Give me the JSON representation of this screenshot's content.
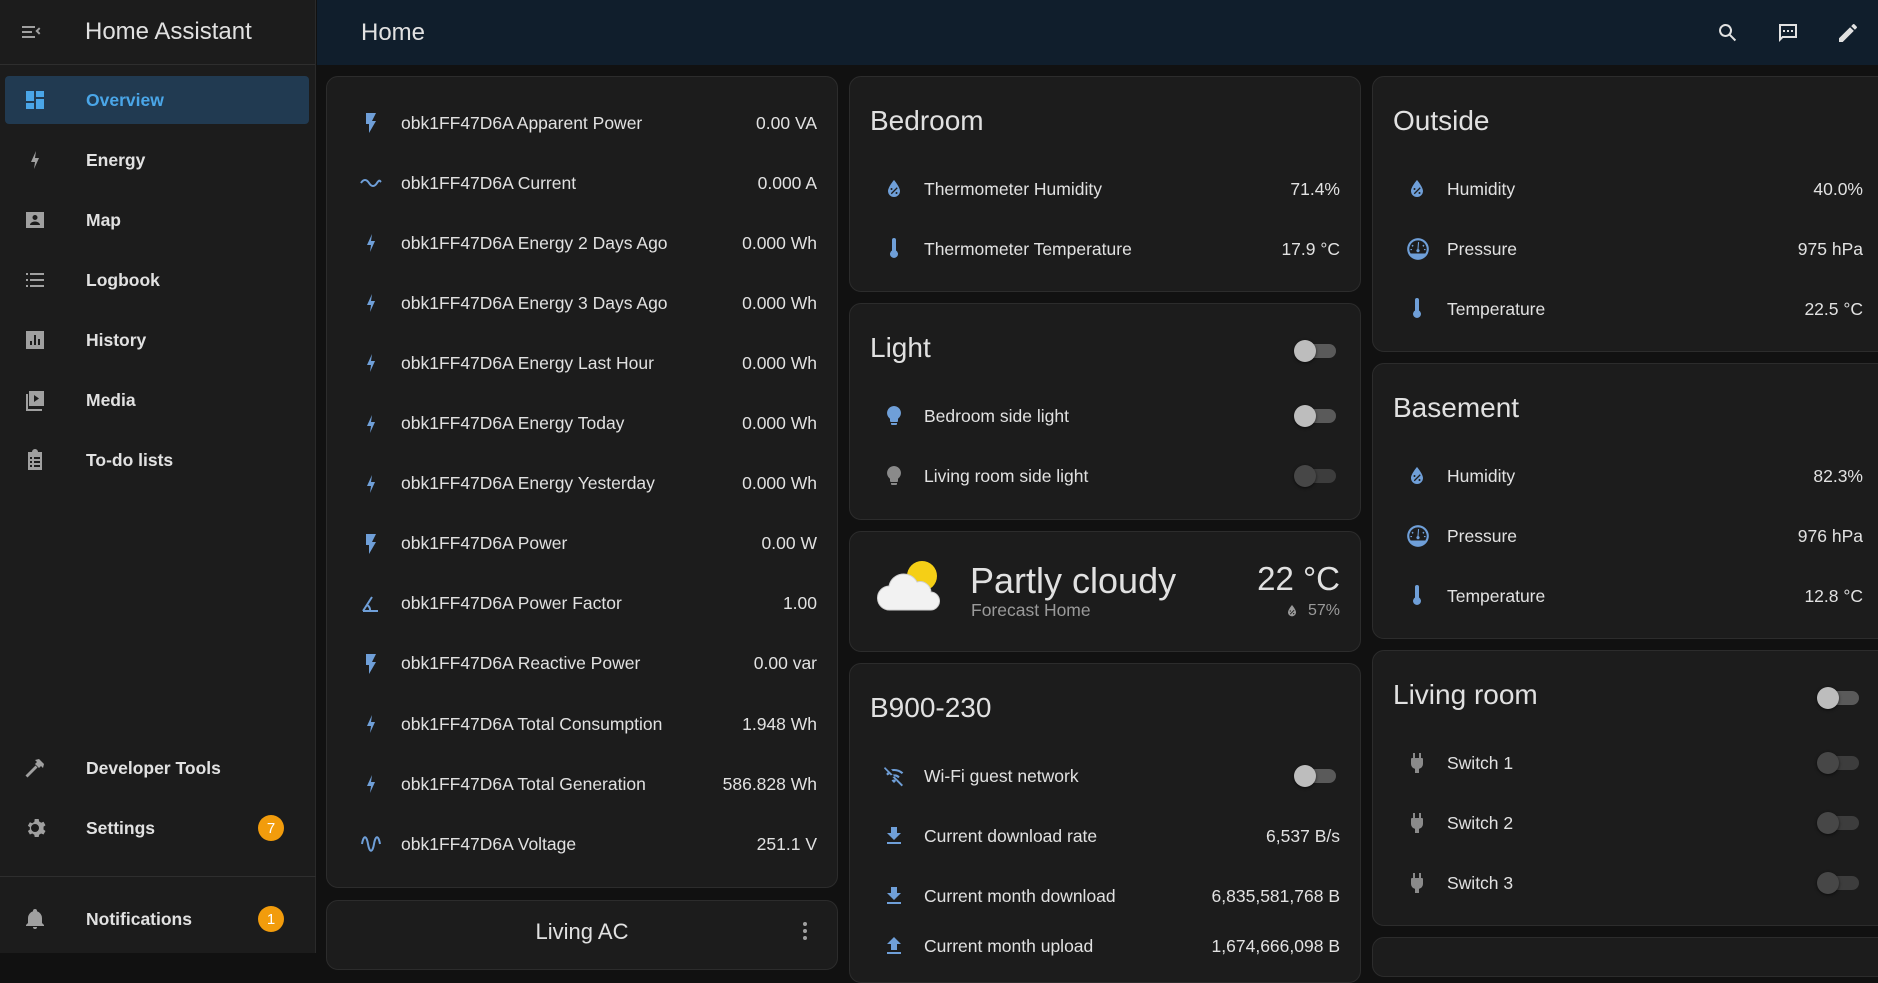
{
  "app": {
    "title": "Home Assistant"
  },
  "page": {
    "title": "Home"
  },
  "sidebar": {
    "items": [
      {
        "label": "Overview"
      },
      {
        "label": "Energy"
      },
      {
        "label": "Map"
      },
      {
        "label": "Logbook"
      },
      {
        "label": "History"
      },
      {
        "label": "Media"
      },
      {
        "label": "To-do lists"
      },
      {
        "label": "Developer Tools"
      },
      {
        "label": "Settings",
        "badge": "7"
      },
      {
        "label": "Notifications",
        "badge": "1"
      }
    ]
  },
  "obk": {
    "rows": [
      {
        "name": "obk1FF47D6A Apparent Power",
        "value": "0.00 VA",
        "icon": "flash-icon"
      },
      {
        "name": "obk1FF47D6A Current",
        "value": "0.000 A",
        "icon": "current-ac-icon"
      },
      {
        "name": "obk1FF47D6A Energy 2 Days Ago",
        "value": "0.000 Wh",
        "icon": "lightning-icon"
      },
      {
        "name": "obk1FF47D6A Energy 3 Days Ago",
        "value": "0.000 Wh",
        "icon": "lightning-icon"
      },
      {
        "name": "obk1FF47D6A Energy Last Hour",
        "value": "0.000 Wh",
        "icon": "lightning-icon"
      },
      {
        "name": "obk1FF47D6A Energy Today",
        "value": "0.000 Wh",
        "icon": "lightning-icon"
      },
      {
        "name": "obk1FF47D6A Energy Yesterday",
        "value": "0.000 Wh",
        "icon": "lightning-icon"
      },
      {
        "name": "obk1FF47D6A Power",
        "value": "0.00 W",
        "icon": "flash-icon"
      },
      {
        "name": "obk1FF47D6A Power Factor",
        "value": "1.00",
        "icon": "angle-icon"
      },
      {
        "name": "obk1FF47D6A Reactive Power",
        "value": "0.00 var",
        "icon": "flash-icon"
      },
      {
        "name": "obk1FF47D6A Total Consumption",
        "value": "1.948 Wh",
        "icon": "lightning-icon"
      },
      {
        "name": "obk1FF47D6A Total Generation",
        "value": "586.828 Wh",
        "icon": "lightning-icon"
      },
      {
        "name": "obk1FF47D6A Voltage",
        "value": "251.1 V",
        "icon": "sine-wave-icon"
      }
    ]
  },
  "living_ac": {
    "title": "Living AC"
  },
  "bedroom": {
    "title": "Bedroom",
    "rows": [
      {
        "name": "Thermometer Humidity",
        "value": "71.4%"
      },
      {
        "name": "Thermometer Temperature",
        "value": "17.9 °C"
      }
    ]
  },
  "light": {
    "title": "Light",
    "rows": [
      {
        "name": "Bedroom side light"
      },
      {
        "name": "Living room side light"
      }
    ]
  },
  "weather": {
    "condition": "Partly cloudy",
    "location": "Forecast Home",
    "temperature": "22 °C",
    "humidity": "57%"
  },
  "router": {
    "title": "B900-230",
    "rows": [
      {
        "name": "Wi-Fi guest network"
      },
      {
        "name": "Current download rate",
        "value": "6,537 B/s"
      },
      {
        "name": "Current month download",
        "value": "6,835,581,768 B"
      },
      {
        "name": "Current month upload",
        "value": "1,674,666,098 B"
      }
    ]
  },
  "outside": {
    "title": "Outside",
    "rows": [
      {
        "name": "Humidity",
        "value": "40.0%"
      },
      {
        "name": "Pressure",
        "value": "975 hPa"
      },
      {
        "name": "Temperature",
        "value": "22.5 °C"
      }
    ]
  },
  "basement": {
    "title": "Basement",
    "rows": [
      {
        "name": "Humidity",
        "value": "82.3%"
      },
      {
        "name": "Pressure",
        "value": "976 hPa"
      },
      {
        "name": "Temperature",
        "value": "12.8 °C"
      }
    ]
  },
  "living_room": {
    "title": "Living room",
    "rows": [
      {
        "name": "Switch 1"
      },
      {
        "name": "Switch 2"
      },
      {
        "name": "Switch 3"
      }
    ]
  },
  "colors": {
    "accent": "#4aa6e8",
    "icon": "#6f9fd8",
    "badge": "#f29c0c",
    "topbar": "#101e2c",
    "card": "#1c1c1c"
  }
}
